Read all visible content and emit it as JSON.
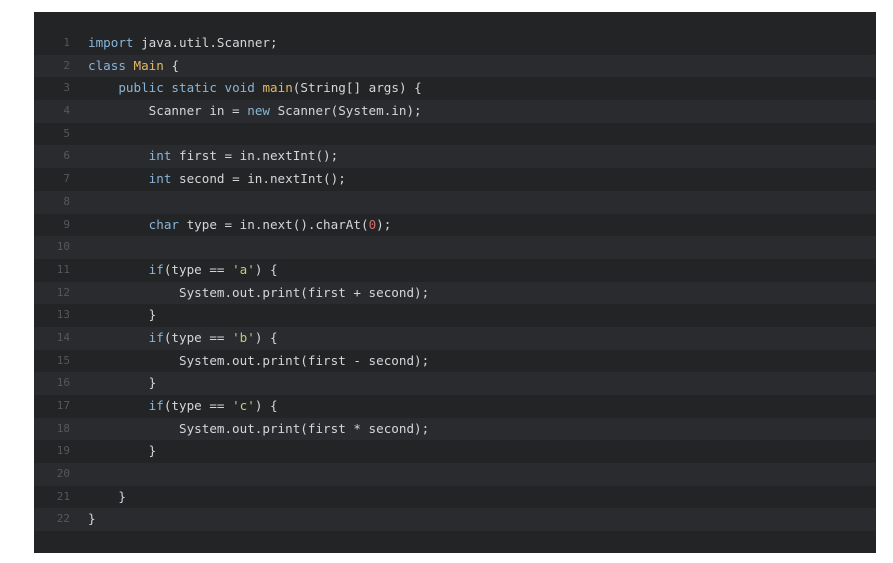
{
  "code": {
    "lines": [
      {
        "number": "1",
        "tokens": [
          {
            "t": "import",
            "k": "kw"
          },
          {
            "t": " java.util.Scanner;",
            "k": "plain"
          }
        ]
      },
      {
        "number": "2",
        "tokens": [
          {
            "t": "class",
            "k": "kw"
          },
          {
            "t": " ",
            "k": "plain"
          },
          {
            "t": "Main",
            "k": "cls"
          },
          {
            "t": " {",
            "k": "plain"
          }
        ]
      },
      {
        "number": "3",
        "tokens": [
          {
            "t": "    public",
            "k": "kw"
          },
          {
            "t": " ",
            "k": "plain"
          },
          {
            "t": "static",
            "k": "kw"
          },
          {
            "t": " ",
            "k": "plain"
          },
          {
            "t": "void",
            "k": "kw"
          },
          {
            "t": " ",
            "k": "plain"
          },
          {
            "t": "main",
            "k": "cls"
          },
          {
            "t": "(String[] args) {",
            "k": "plain"
          }
        ]
      },
      {
        "number": "4",
        "tokens": [
          {
            "t": "        Scanner in = ",
            "k": "plain"
          },
          {
            "t": "new",
            "k": "kw"
          },
          {
            "t": " Scanner(System.in);",
            "k": "plain"
          }
        ]
      },
      {
        "number": "5",
        "tokens": []
      },
      {
        "number": "6",
        "tokens": [
          {
            "t": "        int",
            "k": "kw"
          },
          {
            "t": " first = in.nextInt();",
            "k": "plain"
          }
        ]
      },
      {
        "number": "7",
        "tokens": [
          {
            "t": "        int",
            "k": "kw"
          },
          {
            "t": " second = in.nextInt();",
            "k": "plain"
          }
        ]
      },
      {
        "number": "8",
        "tokens": []
      },
      {
        "number": "9",
        "tokens": [
          {
            "t": "        char",
            "k": "kw"
          },
          {
            "t": " type = in.next().charAt(",
            "k": "plain"
          },
          {
            "t": "0",
            "k": "num"
          },
          {
            "t": ");",
            "k": "plain"
          }
        ]
      },
      {
        "number": "10",
        "tokens": []
      },
      {
        "number": "11",
        "tokens": [
          {
            "t": "        if",
            "k": "kw"
          },
          {
            "t": "(type == ",
            "k": "plain"
          },
          {
            "t": "'a'",
            "k": "str"
          },
          {
            "t": ") {",
            "k": "plain"
          }
        ]
      },
      {
        "number": "12",
        "tokens": [
          {
            "t": "            System.out.print(first + second);",
            "k": "plain"
          }
        ]
      },
      {
        "number": "13",
        "tokens": [
          {
            "t": "        }",
            "k": "plain"
          }
        ]
      },
      {
        "number": "14",
        "tokens": [
          {
            "t": "        if",
            "k": "kw"
          },
          {
            "t": "(type == ",
            "k": "plain"
          },
          {
            "t": "'b'",
            "k": "str"
          },
          {
            "t": ") {",
            "k": "plain"
          }
        ]
      },
      {
        "number": "15",
        "tokens": [
          {
            "t": "            System.out.print(first - second);",
            "k": "plain"
          }
        ]
      },
      {
        "number": "16",
        "tokens": [
          {
            "t": "        }",
            "k": "plain"
          }
        ]
      },
      {
        "number": "17",
        "tokens": [
          {
            "t": "        if",
            "k": "kw"
          },
          {
            "t": "(type == ",
            "k": "plain"
          },
          {
            "t": "'c'",
            "k": "str"
          },
          {
            "t": ") {",
            "k": "plain"
          }
        ]
      },
      {
        "number": "18",
        "tokens": [
          {
            "t": "            System.out.print(first * second);",
            "k": "plain"
          }
        ]
      },
      {
        "number": "19",
        "tokens": [
          {
            "t": "        }",
            "k": "plain"
          }
        ]
      },
      {
        "number": "20",
        "tokens": []
      },
      {
        "number": "21",
        "tokens": [
          {
            "t": "    }",
            "k": "plain"
          }
        ]
      },
      {
        "number": "22",
        "tokens": [
          {
            "t": "}",
            "k": "plain"
          }
        ]
      }
    ]
  },
  "colors": {
    "background": "#232426",
    "keyword": "#8ab4d6",
    "class_name": "#e2b866",
    "string": "#b9cf7a",
    "number": "#d46e6e",
    "text": "#d3d6da",
    "line_number": "#54575c"
  }
}
